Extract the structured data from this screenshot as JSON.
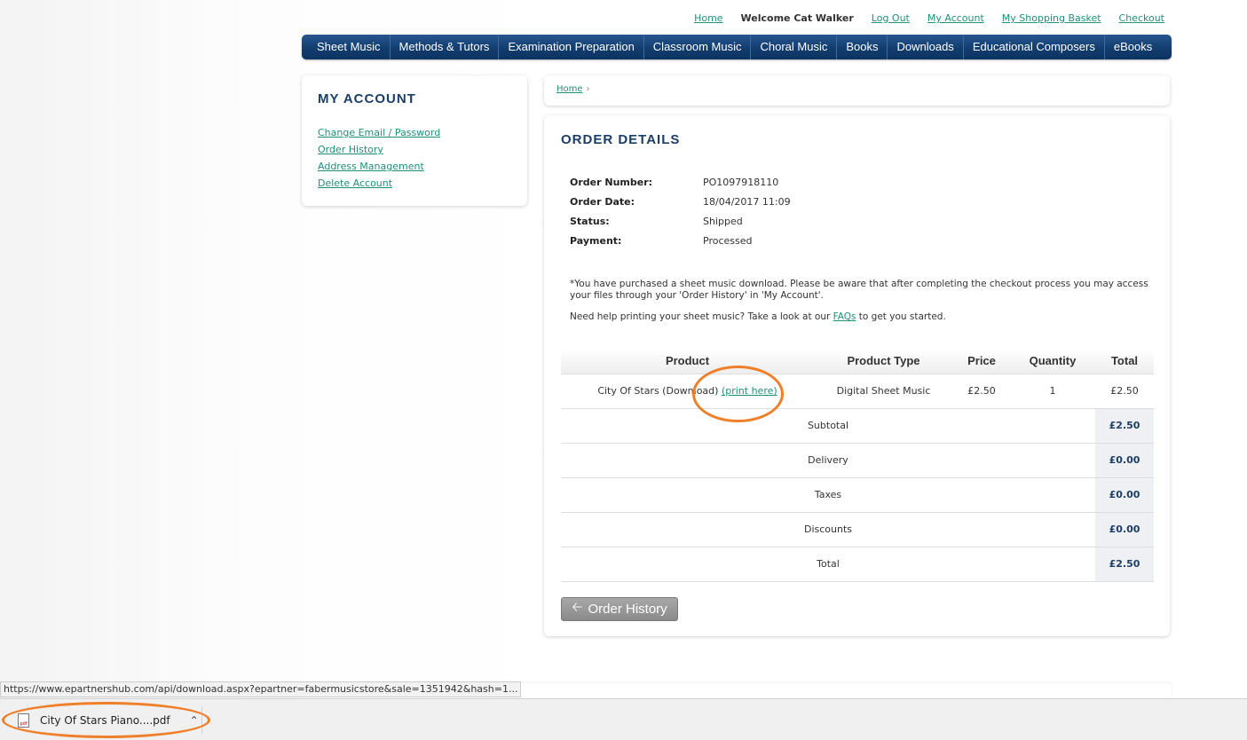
{
  "toplinks": {
    "home": "Home",
    "welcome": "Welcome Cat Walker",
    "logout": "Log Out",
    "my_account": "My Account",
    "basket": "My Shopping Basket",
    "checkout": "Checkout"
  },
  "nav": [
    "Sheet Music",
    "Methods & Tutors",
    "Examination Preparation",
    "Classroom Music",
    "Choral Music",
    "Books",
    "Downloads",
    "Educational Composers",
    "eBooks"
  ],
  "account": {
    "title": "MY ACCOUNT",
    "links": [
      "Change Email / Password",
      "Order History",
      "Address Management",
      "Delete Account"
    ]
  },
  "breadcrumb": {
    "home": "Home",
    "sep": "›"
  },
  "order": {
    "title": "ORDER DETAILS",
    "number_label": "Order Number:",
    "number": "PO1097918110",
    "date_label": "Order Date:",
    "date": "18/04/2017 11:09",
    "status_label": "Status:",
    "status": "Shipped",
    "payment_label": "Payment:",
    "payment": "Processed",
    "notice1": "*You have purchased a sheet music download. Please be aware that after completing the checkout process you may access your files through your 'Order History' in 'My Account'.",
    "notice2_pre": "Need help printing your sheet music? Take a look at our ",
    "notice2_link": "FAQs",
    "notice2_post": " to get you started.",
    "headers": {
      "product": "Product",
      "type": "Product Type",
      "price": "Price",
      "qty": "Quantity",
      "total": "Total"
    },
    "item": {
      "name": "City Of Stars (Download)",
      "print": "(print here)",
      "type": "Digital Sheet Music",
      "price": "£2.50",
      "qty": "1",
      "total": "£2.50"
    },
    "summary": [
      {
        "label": "Subtotal",
        "value": "£2.50"
      },
      {
        "label": "Delivery",
        "value": "£0.00"
      },
      {
        "label": "Taxes",
        "value": "£0.00"
      },
      {
        "label": "Discounts",
        "value": "£0.00"
      },
      {
        "label": "Total",
        "value": "£2.50"
      }
    ],
    "back_button": "Order History"
  },
  "status_url": "https://www.epartnershub.com/api/download.aspx?epartner=fabermusicstore&sale=1351942&hash=1...",
  "download": {
    "filename": "City Of Stars Piano....pdf",
    "icon_text": "pdf"
  },
  "colors": {
    "accent": "#1b3e66",
    "link": "#1f8f7a",
    "annotation": "#f07f2a"
  }
}
